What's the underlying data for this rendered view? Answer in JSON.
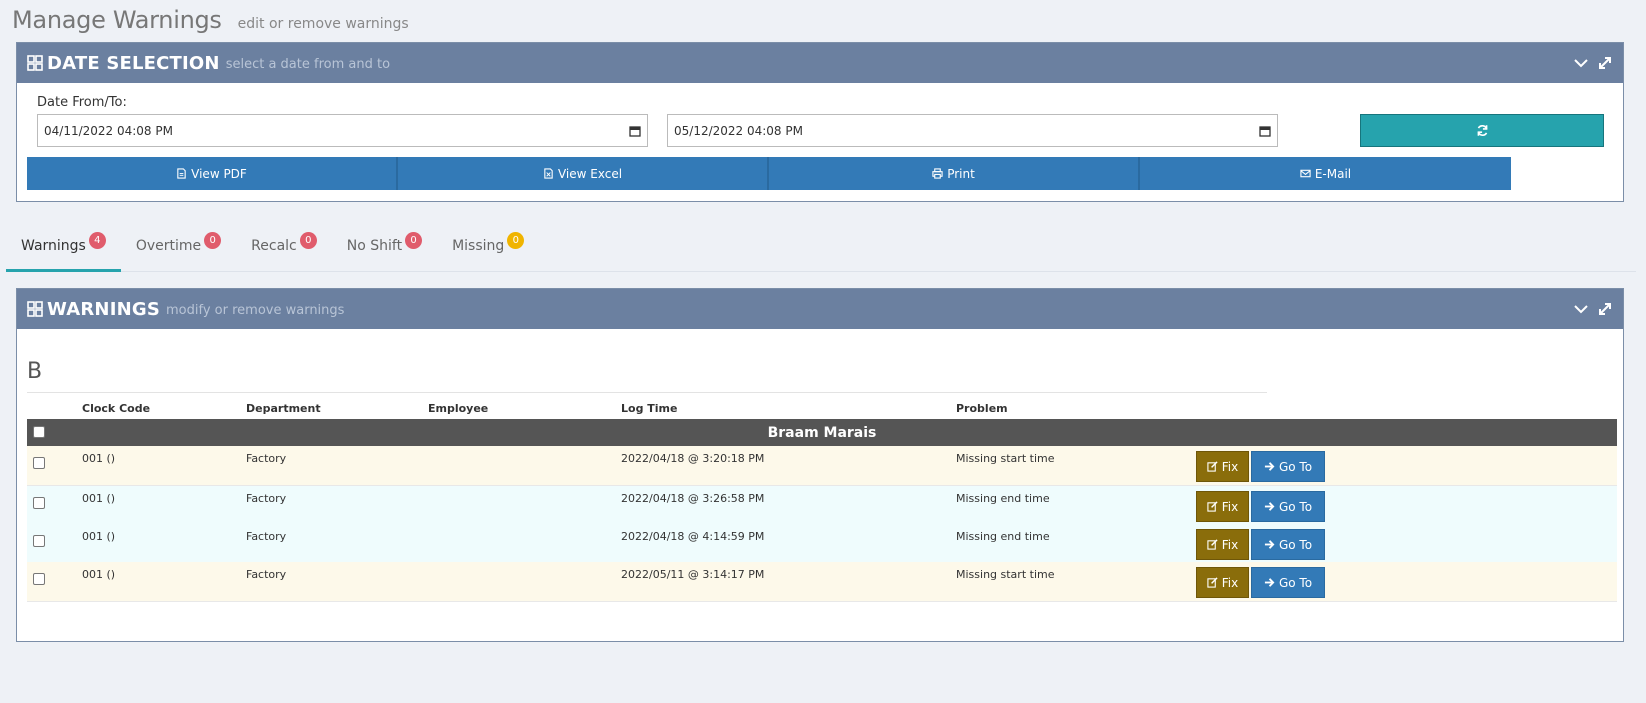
{
  "header": {
    "title": "Manage Warnings",
    "subtitle": "edit or remove warnings"
  },
  "date_panel": {
    "title": "DATE SELECTION",
    "subtitle": "select a date from and to",
    "label": "Date From/To:",
    "from_value": "04/11/2022 04:08 PM",
    "to_value": "05/12/2022 04:08 PM",
    "actions": [
      {
        "label": "View PDF",
        "icon": "file-pdf-icon"
      },
      {
        "label": "View Excel",
        "icon": "file-excel-icon"
      },
      {
        "label": "Print",
        "icon": "print-icon"
      },
      {
        "label": "E-Mail",
        "icon": "envelope-icon"
      }
    ]
  },
  "tabs": [
    {
      "label": "Warnings",
      "count": "4",
      "active": true
    },
    {
      "label": "Overtime",
      "count": "0"
    },
    {
      "label": "Recalc",
      "count": "0"
    },
    {
      "label": "No Shift",
      "count": "0"
    },
    {
      "label": "Missing",
      "count": "0"
    }
  ],
  "warnings_panel": {
    "title": "WARNINGS",
    "subtitle": "modify or remove warnings",
    "section_letter": "B",
    "columns": [
      "Clock Code",
      "Department",
      "Employee",
      "Log Time",
      "Problem"
    ],
    "group_name": "Braam Marais",
    "fix_label": "Fix",
    "goto_label": "Go To",
    "rows": [
      {
        "clock_code": "001 ()",
        "department": "Factory",
        "employee": "",
        "log_time": "2022/04/18 @ 3:20:18 PM",
        "problem": "Missing start time"
      },
      {
        "clock_code": "001 ()",
        "department": "Factory",
        "employee": "",
        "log_time": "2022/04/18 @ 3:26:58 PM",
        "problem": "Missing end time"
      },
      {
        "clock_code": "001 ()",
        "department": "Factory",
        "employee": "",
        "log_time": "2022/04/18 @ 4:14:59 PM",
        "problem": "Missing end time"
      },
      {
        "clock_code": "001 ()",
        "department": "Factory",
        "employee": "",
        "log_time": "2022/05/11 @ 3:14:17 PM",
        "problem": "Missing start time"
      }
    ]
  },
  "colors": {
    "panel_header": "#6b80a0",
    "primary": "#337ab7",
    "teal": "#26a3ad",
    "fix": "#8a6d0b",
    "badge_red": "#e05c6c",
    "badge_yellow": "#f0b400"
  }
}
